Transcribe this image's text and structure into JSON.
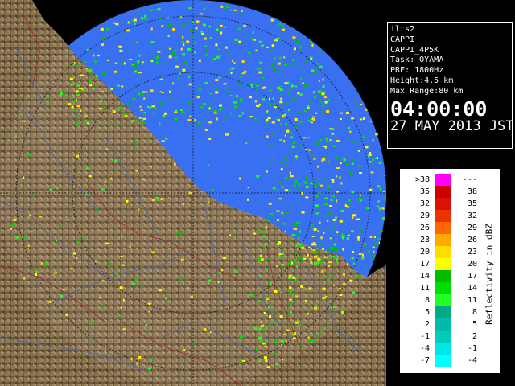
{
  "info": {
    "site": "ilts2",
    "product": "CAPPI",
    "product_code": "CAPPI_4P5K",
    "task": "Task: OYAMA",
    "prf": "PRF: 1800Hz",
    "height": "Height:4.5 km",
    "max_range": "Max Range:80 km",
    "time": "04:00:00",
    "date": "27 MAY 2013 JST"
  },
  "legend": {
    "unit_label": "Reflectivity in dBZ",
    "rows": [
      {
        "lo": ">38",
        "hi": "---",
        "color": "#ff00ff"
      },
      {
        "lo": "35",
        "hi": "38",
        "color": "#cc0000"
      },
      {
        "lo": "32",
        "hi": "35",
        "color": "#dd1100"
      },
      {
        "lo": "29",
        "hi": "32",
        "color": "#ee3300"
      },
      {
        "lo": "26",
        "hi": "29",
        "color": "#ff6600"
      },
      {
        "lo": "23",
        "hi": "26",
        "color": "#ffaa00"
      },
      {
        "lo": "20",
        "hi": "23",
        "color": "#ffdd00"
      },
      {
        "lo": "17",
        "hi": "20",
        "color": "#ffff00"
      },
      {
        "lo": "14",
        "hi": "17",
        "color": "#00bb00"
      },
      {
        "lo": "11",
        "hi": "14",
        "color": "#00dd00"
      },
      {
        "lo": "8",
        "hi": "11",
        "color": "#22ff22"
      },
      {
        "lo": "5",
        "hi": "8",
        "color": "#00aa88"
      },
      {
        "lo": "2",
        "hi": "5",
        "color": "#00bbaa"
      },
      {
        "lo": "-1",
        "hi": "2",
        "color": "#00ccbb"
      },
      {
        "lo": "-4",
        "hi": "-1",
        "color": "#00e5e5"
      },
      {
        "lo": "-7",
        "hi": "-4",
        "color": "#00ffff"
      }
    ]
  },
  "colors": {
    "sea": "#2a66f0",
    "land": "#6e5a3c",
    "rivers": "#4a6aa8",
    "boundaries": "#a03030",
    "range_rings": "#333333"
  }
}
